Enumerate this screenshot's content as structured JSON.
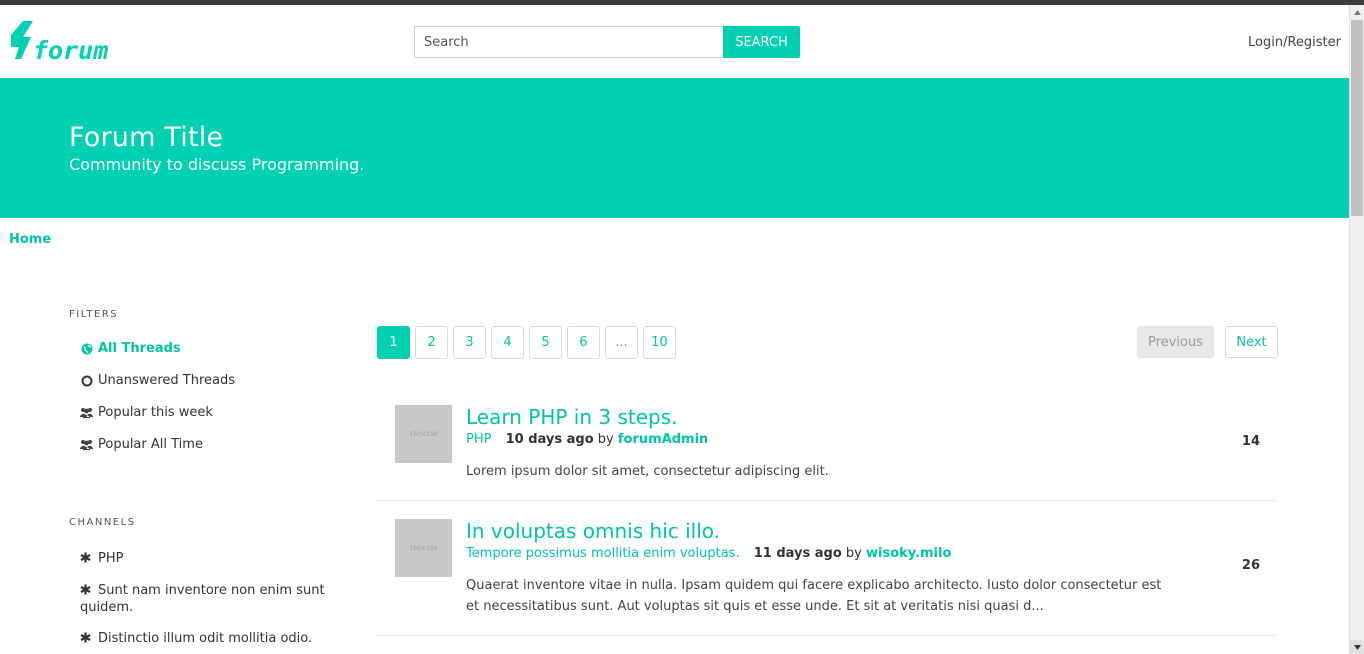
{
  "colors": {
    "accent": "#00d1b2",
    "accent_text": "#00c4a7",
    "topbar": "#3c3c3c"
  },
  "header": {
    "logo_text": "forum",
    "search": {
      "placeholder": "Search",
      "value": "",
      "button_label": "SEARCH"
    },
    "login_label": "Login/Register"
  },
  "hero": {
    "title": "Forum Title",
    "subtitle": "Community to discuss Programming."
  },
  "breadcrumb": {
    "home": "Home"
  },
  "sidebar": {
    "filters_label": "FILTERS",
    "filters": [
      {
        "label": "All Threads",
        "icon": "globe-icon",
        "active": true
      },
      {
        "label": "Unanswered Threads",
        "icon": "circle-outline-icon",
        "active": false
      },
      {
        "label": "Popular this week",
        "icon": "users-icon",
        "active": false
      },
      {
        "label": "Popular All Time",
        "icon": "users-icon",
        "active": false
      }
    ],
    "channels_label": "CHANNELS",
    "channels": [
      {
        "label": "PHP",
        "icon": "asterisk-icon"
      },
      {
        "label": "Sunt nam inventore non enim sunt quidem.",
        "icon": "asterisk-icon"
      },
      {
        "label": "Distinctio illum odit mollitia odio.",
        "icon": "asterisk-icon"
      }
    ]
  },
  "pagination": {
    "pages": [
      "1",
      "2",
      "3",
      "4",
      "5",
      "6",
      "...",
      "10"
    ],
    "current": "1",
    "previous_label": "Previous",
    "next_label": "Next"
  },
  "threads": [
    {
      "title": "Learn PHP in 3 steps.",
      "channel": "PHP",
      "time": "10 days ago",
      "by": "by",
      "author": "forumAdmin",
      "body": "Lorem ipsum dolor sit amet, consectetur adipiscing elit.",
      "replies": "14",
      "thumb_text": "150×150"
    },
    {
      "title": "In voluptas omnis hic illo.",
      "channel": "Tempore possimus mollitia enim voluptas.",
      "time": "11 days ago",
      "by": "by",
      "author": "wisoky.milo",
      "body": "Quaerat inventore vitae in nulla. Ipsam quidem qui facere explicabo architecto. Iusto dolor consectetur est et necessitatibus sunt. Aut voluptas sit quis et esse unde. Et sit at veritatis nisi quasi d...",
      "replies": "26",
      "thumb_text": "150×150"
    }
  ]
}
